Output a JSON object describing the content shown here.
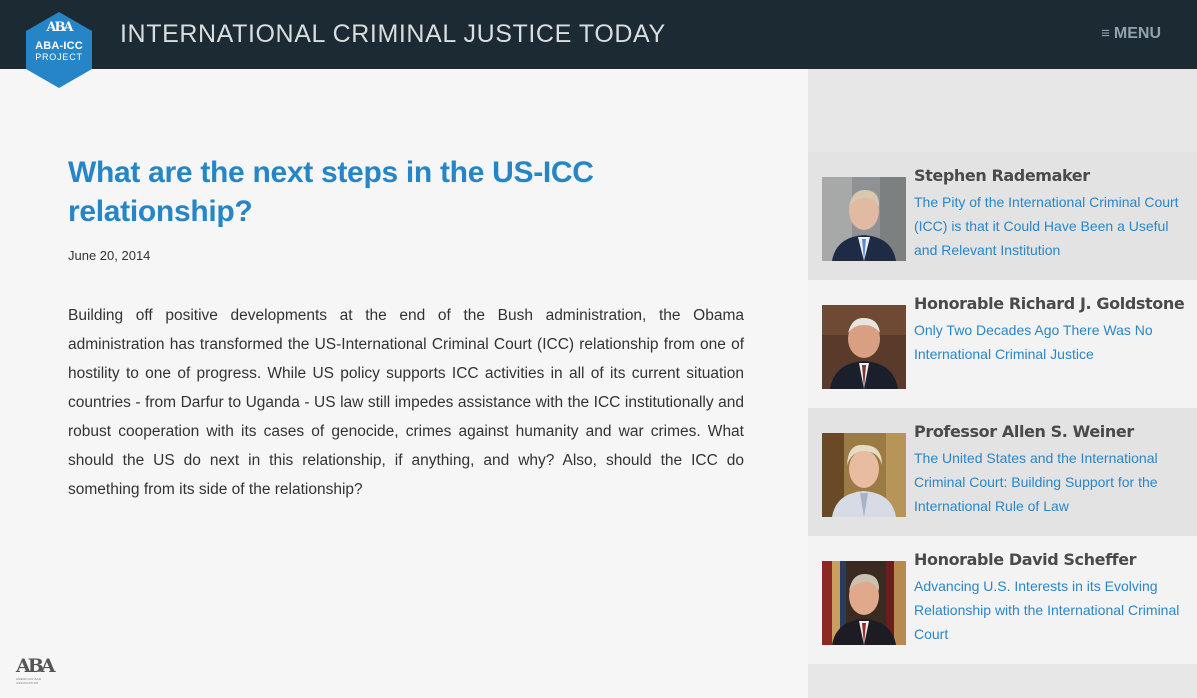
{
  "header": {
    "logo_line1": "ABA-ICC",
    "logo_line2": "PROJECT",
    "logo_mark": "ABA",
    "site_title": "INTERNATIONAL CRIMINAL JUSTICE TODAY",
    "menu_icon": "hamburger-icon",
    "menu_label": "MENU"
  },
  "article": {
    "title": "What are the next steps in the US-ICC relationship?",
    "date": "June 20, 2014",
    "body": "Building off positive developments at the end of the Bush administration, the Obama administration has transformed the US-International Criminal Court (ICC) relationship from one of hostility to one of progress. While US policy supports ICC activities in all of its current situation countries - from Darfur to Uganda - US law still impedes assistance with the ICC institutionally and robust cooperation with its cases of genocide, crimes against humanity and war crimes. What should the US do next in this relationship, if anything, and why? Also, should the ICC do something from its side of the relationship?"
  },
  "footer": {
    "aba_mark": "ABA",
    "aba_caption": "AMERICAN BAR ASSOCIATION"
  },
  "sidebar": {
    "entries": [
      {
        "name": "Stephen Rademaker",
        "link": "The Pity of the International Criminal Court (ICC) is that it Could Have Been a Useful and Relevant Institution"
      },
      {
        "name": "Honorable Richard J. Goldstone",
        "link": "Only Two Decades Ago There Was No International Criminal Justice"
      },
      {
        "name": "Professor Allen S. Weiner",
        "link": "The United States and the International Criminal Court: Building Support for the International Rule of Law"
      },
      {
        "name": "Honorable David Scheffer",
        "link": "Advancing U.S. Interests in its Evolving Relationship with the International Criminal Court"
      }
    ]
  },
  "colors": {
    "header_bg": "#1b2a33",
    "logo_blue": "#2585c7",
    "title_blue": "#2585c7",
    "link_blue": "#2a86c8"
  }
}
